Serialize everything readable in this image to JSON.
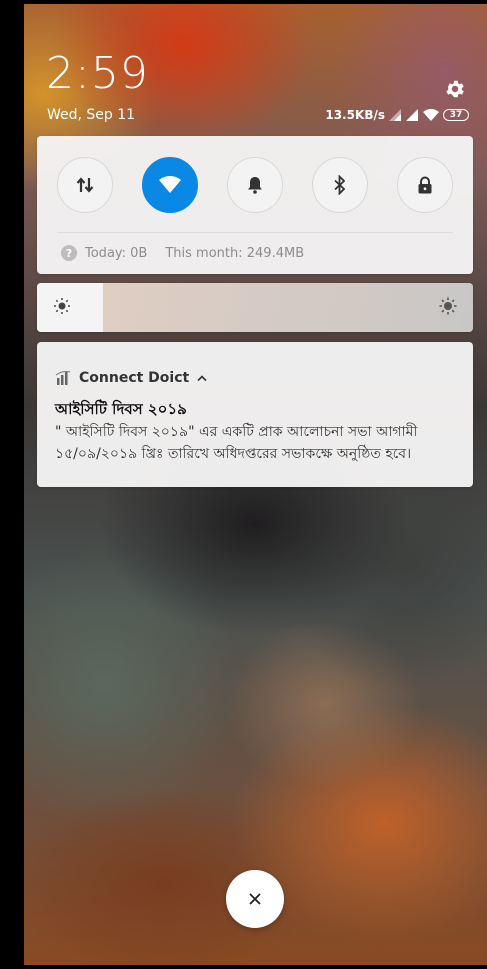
{
  "status_bar": {
    "time": "2:59",
    "date": "Wed, Sep 11",
    "network_speed": "13.5KB/s",
    "battery_level": "37"
  },
  "quick_settings": {
    "toggles": [
      {
        "name": "mobile-data",
        "icon": "data-arrows-icon",
        "active": false
      },
      {
        "name": "wifi",
        "icon": "wifi-icon",
        "active": true
      },
      {
        "name": "sound",
        "icon": "bell-icon",
        "active": false
      },
      {
        "name": "bluetooth",
        "icon": "bluetooth-icon",
        "active": false
      },
      {
        "name": "lock",
        "icon": "lock-icon",
        "active": false
      }
    ],
    "usage_today": "Today: 0B",
    "usage_month": "This month: 249.4MB",
    "accent_color": "#0a88e6"
  },
  "brightness": {
    "level": 0.08
  },
  "notification": {
    "app_name": "Connect Doict",
    "title": "আইসিটি দিবস ২০১৯",
    "body": "\" আইসিটি দিবস ২০১৯\" এর একটি প্রাক আলোচনা সভা আগামী ১৫/০৯/২০১৯ খ্রিঃ তারিখে অধিদপ্তরের সভাকক্ষে অনুষ্ঠিত হবে।"
  },
  "dismiss": {
    "label": "×"
  }
}
